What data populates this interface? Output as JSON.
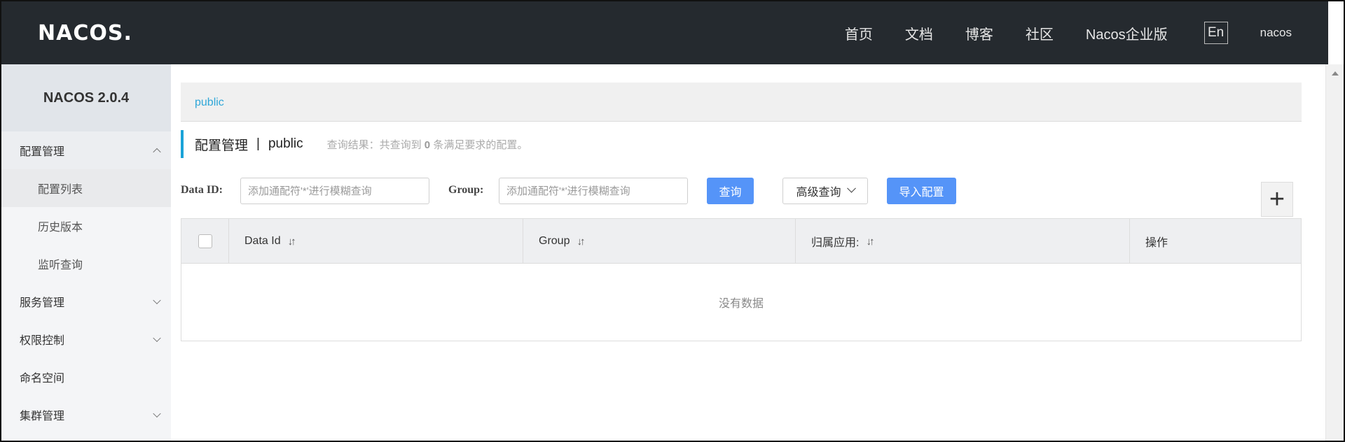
{
  "header": {
    "logo": "NACOS.",
    "nav": [
      "首页",
      "文档",
      "博客",
      "社区",
      "Nacos企业版"
    ],
    "lang": "En",
    "user": "nacos"
  },
  "sidebar": {
    "brand": "NACOS 2.0.4",
    "items": [
      {
        "label": "配置管理",
        "expanded": true
      },
      {
        "label": "配置列表"
      },
      {
        "label": "历史版本"
      },
      {
        "label": "监听查询"
      },
      {
        "label": "服务管理",
        "expanded": false
      },
      {
        "label": "权限控制",
        "expanded": false
      },
      {
        "label": "命名空间"
      },
      {
        "label": "集群管理",
        "expanded": false
      }
    ]
  },
  "main": {
    "namespace_link": "public",
    "title": "配置管理",
    "separator": "|",
    "title_ns": "public",
    "result_prefix": "查询结果：共查询到",
    "result_count": "0",
    "result_suffix": "条满足要求的配置。",
    "filters": {
      "data_id_label": "Data ID:",
      "data_id_placeholder": "添加通配符'*'进行模糊查询",
      "group_label": "Group:",
      "group_placeholder": "添加通配符'*'进行模糊查询",
      "query_button": "查询",
      "advanced_button": "高级查询",
      "import_button": "导入配置",
      "add_button": "+"
    },
    "table": {
      "columns": [
        "Data Id",
        "Group",
        "归属应用:",
        "操作"
      ],
      "empty_text": "没有数据"
    }
  },
  "colors": {
    "header_bg": "#252a2f",
    "accent": "#1aa3d8",
    "primary_button": "#5594f8"
  }
}
